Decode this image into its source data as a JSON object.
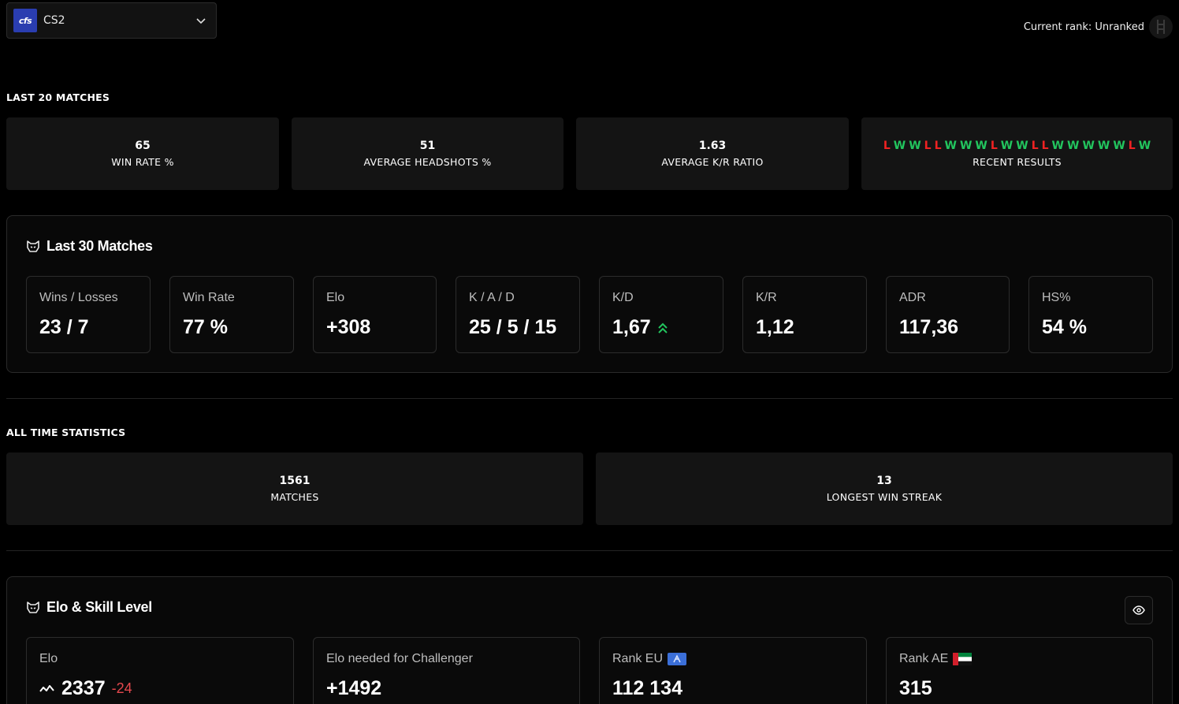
{
  "header": {
    "game_logo_text": "cfs",
    "game_name": "CS2",
    "rank_text": "Current rank: Unranked"
  },
  "last20": {
    "title": "LAST 20 MATCHES",
    "win_rate": {
      "value": "65",
      "label": "WIN RATE %"
    },
    "headshots": {
      "value": "51",
      "label": "AVERAGE HEADSHOTS %"
    },
    "kr_ratio": {
      "value": "1.63",
      "label": "AVERAGE K/R RATIO"
    },
    "recent": {
      "label": "RECENT RESULTS",
      "results": [
        "L",
        "W",
        "W",
        "L",
        "L",
        "W",
        "W",
        "W",
        "L",
        "W",
        "W",
        "L",
        "L",
        "W",
        "W",
        "W",
        "W",
        "W",
        "L",
        "W"
      ]
    }
  },
  "last30": {
    "title": "Last 30 Matches",
    "cards": [
      {
        "label": "Wins / Losses",
        "value": "23 / 7"
      },
      {
        "label": "Win Rate",
        "value": "77 %"
      },
      {
        "label": "Elo",
        "value": "+308"
      },
      {
        "label": "K / A / D",
        "value": "25 / 5 / 15"
      },
      {
        "label": "K/D",
        "value": "1,67"
      },
      {
        "label": "K/R",
        "value": "1,12"
      },
      {
        "label": "ADR",
        "value": "117,36"
      },
      {
        "label": "HS%",
        "value": "54 %"
      }
    ]
  },
  "alltime": {
    "title": "ALL TIME STATISTICS",
    "matches": {
      "value": "1561",
      "label": "MATCHES"
    },
    "streak": {
      "value": "13",
      "label": "LONGEST WIN STREAK"
    }
  },
  "elo_skill": {
    "title": "Elo & Skill Level",
    "elo": {
      "label": "Elo",
      "value": "2337",
      "delta": "-24"
    },
    "challenger": {
      "label": "Elo needed for Challenger",
      "value": "+1492"
    },
    "rank_eu": {
      "label": "Rank EU",
      "value": "112 134"
    },
    "rank_ae": {
      "label": "Rank AE",
      "value": "315"
    }
  },
  "colors": {
    "win": "#22c55e",
    "loss": "#ef2222",
    "delta_negative": "#e5484d",
    "card_bg": "#141414"
  }
}
